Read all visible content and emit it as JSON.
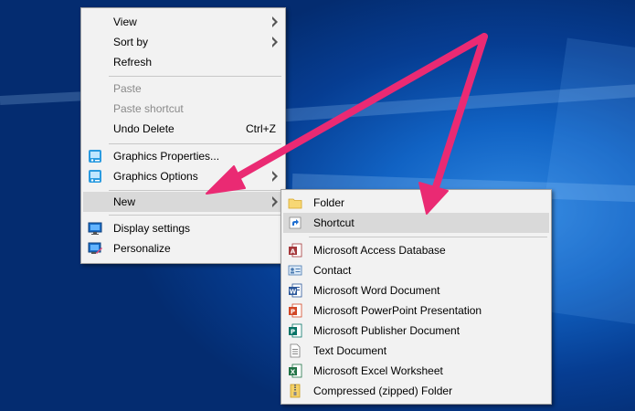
{
  "desktop_menu": {
    "items": [
      {
        "label": "View"
      },
      {
        "label": "Sort by"
      },
      {
        "label": "Refresh"
      },
      {
        "label": "Paste"
      },
      {
        "label": "Paste shortcut"
      },
      {
        "label": "Undo Delete",
        "accel": "Ctrl+Z"
      },
      {
        "label": "Graphics Properties..."
      },
      {
        "label": "Graphics Options"
      },
      {
        "label": "New"
      },
      {
        "label": "Display settings"
      },
      {
        "label": "Personalize"
      }
    ]
  },
  "new_submenu": {
    "items": [
      {
        "label": "Folder",
        "icon": "folder-icon"
      },
      {
        "label": "Shortcut",
        "icon": "shortcut-icon"
      },
      {
        "label": "Microsoft Access Database",
        "icon": "access-icon"
      },
      {
        "label": "Contact",
        "icon": "contact-icon"
      },
      {
        "label": "Microsoft Word Document",
        "icon": "word-icon"
      },
      {
        "label": "Microsoft PowerPoint Presentation",
        "icon": "powerpoint-icon"
      },
      {
        "label": "Microsoft Publisher Document",
        "icon": "publisher-icon"
      },
      {
        "label": "Text Document",
        "icon": "text-document-icon"
      },
      {
        "label": "Microsoft Excel Worksheet",
        "icon": "excel-icon"
      },
      {
        "label": "Compressed (zipped) Folder",
        "icon": "zip-folder-icon"
      }
    ]
  },
  "colors": {
    "menu_bg": "#f2f2f2",
    "highlight": "#d9d9d9",
    "annotation_arrow": "#ea2a73",
    "desktop_blue": "#0a4ea8"
  }
}
